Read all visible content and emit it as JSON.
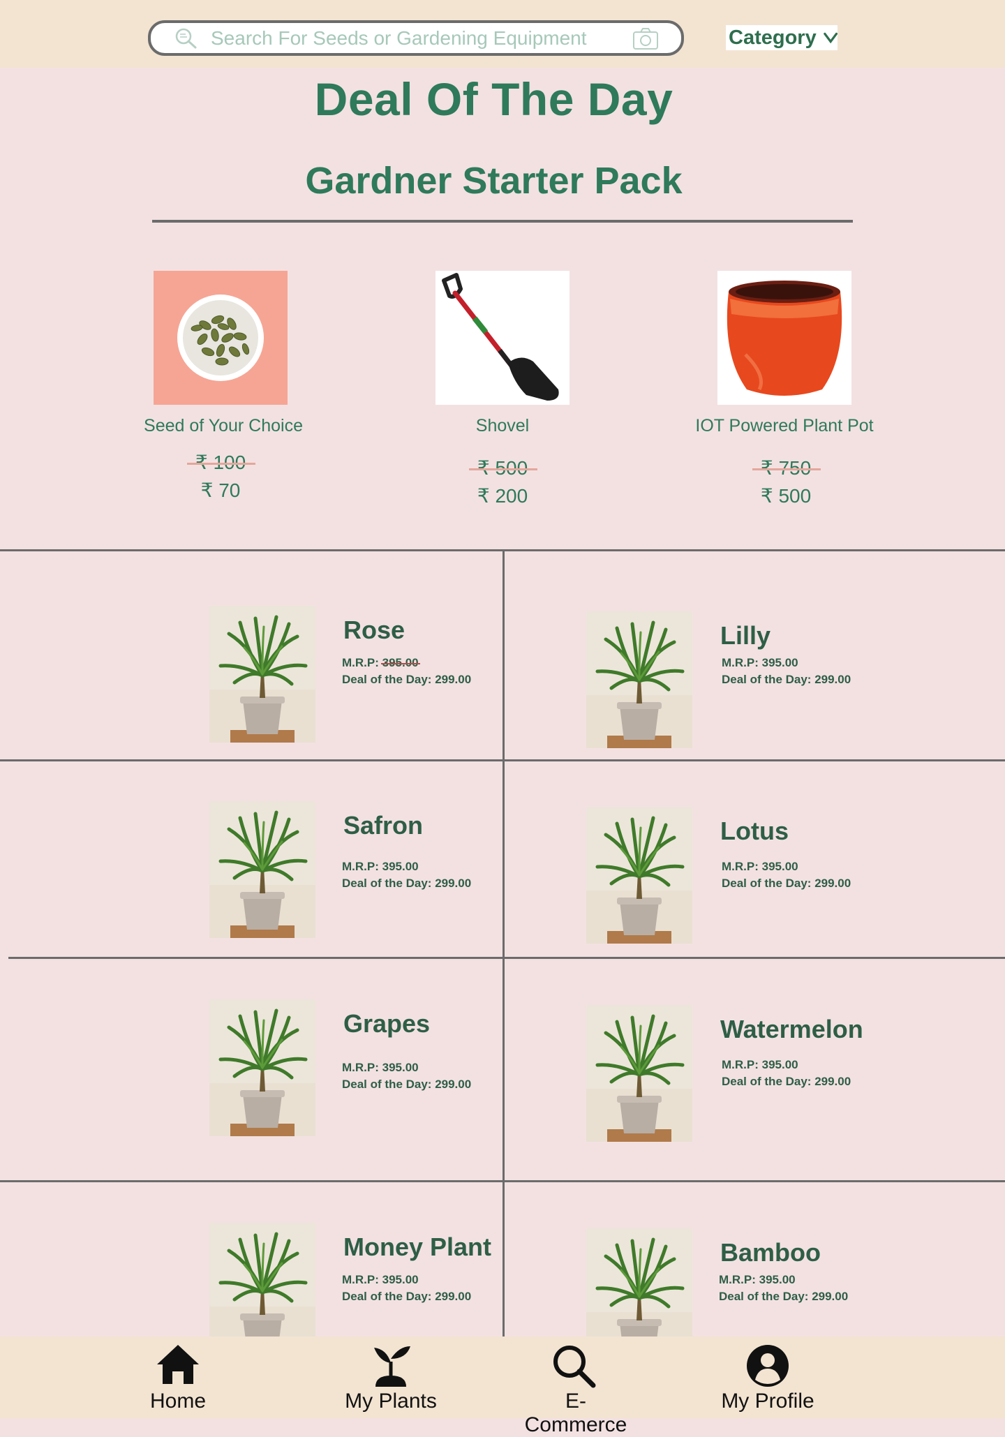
{
  "search": {
    "placeholder": "Search For Seeds or Gardening Equipment",
    "category_label": "Category"
  },
  "deal": {
    "title": "Deal Of The Day",
    "pack_title": "Gardner Starter Pack",
    "items": [
      {
        "name": "Seed of Your Choice",
        "old_price": "₹ 100",
        "new_price": "₹ 70"
      },
      {
        "name": "Shovel",
        "old_price": "₹ 500",
        "new_price": "₹ 200"
      },
      {
        "name": "IOT Powered Plant Pot",
        "old_price": "₹ 750",
        "new_price": "₹ 500"
      }
    ]
  },
  "products": [
    {
      "name": "Rose",
      "mrp_label": "M.R.P: ",
      "mrp_value": "395.00",
      "deal": "Deal of the Day: 299.00"
    },
    {
      "name": "Lilly",
      "mrp_label": "M.R.P: ",
      "mrp_value": "395.00",
      "deal": "Deal of the Day: 299.00"
    },
    {
      "name": "Safron",
      "mrp_label": "M.R.P: ",
      "mrp_value": "395.00",
      "deal": "Deal of the Day: 299.00"
    },
    {
      "name": "Lotus",
      "mrp_label": "M.R.P: ",
      "mrp_value": "395.00",
      "deal": "Deal of the Day: 299.00"
    },
    {
      "name": "Grapes",
      "mrp_label": "M.R.P: ",
      "mrp_value": "395.00",
      "deal": "Deal of the Day: 299.00"
    },
    {
      "name": "Watermelon",
      "mrp_label": "M.R.P: ",
      "mrp_value": "395.00",
      "deal": "Deal of the Day: 299.00"
    },
    {
      "name": "Money Plant",
      "mrp_label": "M.R.P: ",
      "mrp_value": "395.00",
      "deal": "Deal of the Day: 299.00"
    },
    {
      "name": "Bamboo",
      "mrp_label": "M.R.P: ",
      "mrp_value": "395.00",
      "deal": "Deal of the Day: 299.00"
    }
  ],
  "nav": {
    "home": "Home",
    "my_plants": "My Plants",
    "ecommerce": "E-Commerce",
    "my_profile": "My Profile"
  },
  "colors": {
    "page_bg": "#f3e1e2",
    "bar_bg": "#f3e4d2",
    "accent_green": "#2e7a5a",
    "divider": "#6b6b6b"
  }
}
